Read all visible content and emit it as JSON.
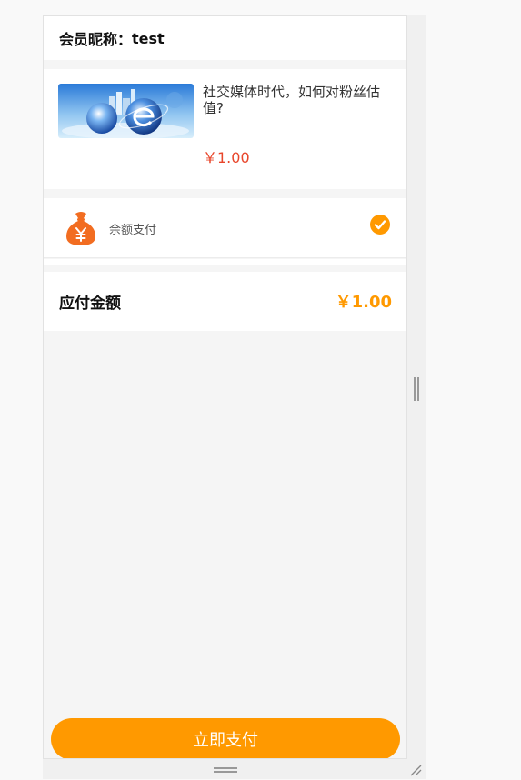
{
  "member": {
    "label": "会员昵称：",
    "name": "test"
  },
  "product": {
    "title": "社交媒体时代，如何对粉丝估值?",
    "price": "￥1.00",
    "thumbnail_icon": "globe-tech-image"
  },
  "payment": {
    "method_label": "余额支付",
    "method_icon": "moneybag-icon",
    "selected": true
  },
  "amount": {
    "label": "应付金额",
    "value": "￥1.00"
  },
  "actions": {
    "pay_button_label": "立即支付"
  },
  "colors": {
    "accent": "#ff9900",
    "price_red": "#e8462b",
    "moneybag": "#f26d21",
    "background": "#f5f5f5"
  }
}
